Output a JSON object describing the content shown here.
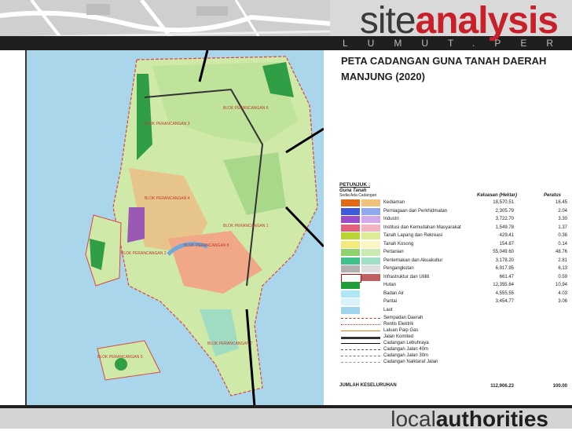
{
  "header": {
    "brand_light": "site",
    "brand_bold": "analysis",
    "subtitle": "LUMUT.PERAK"
  },
  "slide": {
    "title": "PETA CADANGAN  GUNA TANAH DAERAH MANJUNG (2020)"
  },
  "map": {
    "blocks": [
      "BLOK PERANCANGAN 1",
      "BLOK PERANCANGAN 2",
      "BLOK PERANCANGAN 3",
      "BLOK PERANCANGAN 4",
      "BLOK PERANCANGAN 5",
      "BLOK PERANCANGAN 6",
      "BLOK PERANCANGAN 7",
      "BLOK PERANCANGAN 8"
    ]
  },
  "legend": {
    "title": "PETUNJUK :",
    "subtitle": "Guna Tanah",
    "subheads": "Sedia Ada   Cadangan",
    "col_area": "Keluasan (Hektar)",
    "col_pct": "Peratus",
    "rows": [
      {
        "label": "Kediaman",
        "area": "18,570.51",
        "pct": "16.45",
        "c1": "#e06b14",
        "c2": "#f0c17a"
      },
      {
        "label": "Perniagaan dan Perkhidmatan",
        "area": "2,305.79",
        "pct": "2.04",
        "c1": "#3b5bdb",
        "c2": "#8fa8f0"
      },
      {
        "label": "Industri",
        "area": "3,722.70",
        "pct": "3.30",
        "c1": "#9b4dca",
        "c2": "#d1a8ea"
      },
      {
        "label": "Institusi dan Kemudahan Masyarakat",
        "area": "1,549.78",
        "pct": "1.37",
        "c1": "#e0607e",
        "c2": "#f3b3c2"
      },
      {
        "label": "Tanah Lapang dan Rekreasi",
        "area": "429.41",
        "pct": "0.38",
        "c1": "#b7d432",
        "c2": "#dcec95"
      },
      {
        "label": "Tanah Kosong",
        "area": "154.87",
        "pct": "0.14",
        "c1": "#f2ea7a",
        "c2": "#faf5c3"
      },
      {
        "label": "Pertanian",
        "area": "55,049.60",
        "pct": "48.76",
        "c1": "#8fd16a",
        "c2": "#c9eab2"
      },
      {
        "label": "Penternakan dan Akuakultur",
        "area": "3,178.20",
        "pct": "2.81",
        "c1": "#3fbf8a",
        "c2": "#9fe0c4"
      },
      {
        "label": "Pengangkutan",
        "area": "6,917.95",
        "pct": "6.13",
        "c1": "#b0b0b0",
        "c2": "#dedede"
      },
      {
        "label": "Infrastruktur dan Utiliti",
        "area": "661.47",
        "pct": "0.59",
        "c1": "#ffffff",
        "c2": "#c06060"
      },
      {
        "label": "Hutan",
        "area": "12,355.84",
        "pct": "10.94",
        "c1": "#1f9e3a",
        "c2": ""
      },
      {
        "label": "Badan Air",
        "area": "4,555.55",
        "pct": "4.03",
        "c1": "#aee6f2",
        "c2": ""
      },
      {
        "label": "Pantai",
        "area": "3,454.77",
        "pct": "3.06",
        "c1": "#d8f3f8",
        "c2": ""
      },
      {
        "label": "Laut",
        "area": "",
        "pct": "",
        "c1": "#9fd4ea",
        "c2": ""
      }
    ],
    "lines": [
      {
        "label": "Sempadan Daerah",
        "style": "dashed",
        "color": "#c0392b"
      },
      {
        "label": "Rentis Elektrik",
        "style": "dotted",
        "color": "#c0392b"
      },
      {
        "label": "Laluan Paip Gas",
        "style": "solid",
        "color": "#e67e22"
      },
      {
        "label": "Jalan Komited",
        "style": "solid-thick",
        "color": "#333333"
      },
      {
        "label": "Cadangan Lebuhraya",
        "style": "solid",
        "color": "#000000"
      },
      {
        "label": "Cadangan Jalan 40m",
        "style": "dashed",
        "color": "#555555"
      },
      {
        "label": "Cadangan Jalan 30m",
        "style": "dashed",
        "color": "#777777"
      },
      {
        "label": "Cadangan Naiktaraf Jalan",
        "style": "dashed",
        "color": "#999999"
      }
    ],
    "total_label": "JUMLAH KESELURUHAN",
    "total_area": "112,906.23",
    "total_pct": "100.00"
  },
  "footer": {
    "brand_light": "local",
    "brand_bold": "authorities"
  }
}
